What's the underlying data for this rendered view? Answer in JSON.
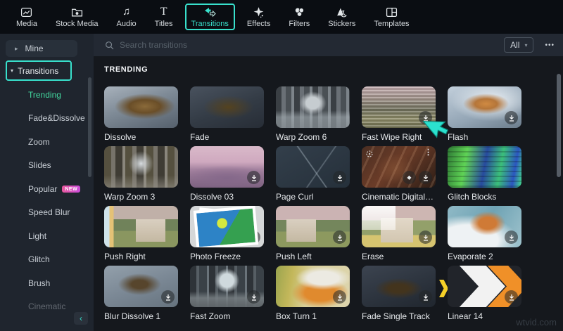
{
  "toolbar": {
    "items": [
      {
        "label": "Media",
        "icon": "media-icon"
      },
      {
        "label": "Stock Media",
        "icon": "stock-media-icon"
      },
      {
        "label": "Audio",
        "icon": "audio-icon"
      },
      {
        "label": "Titles",
        "icon": "titles-icon"
      },
      {
        "label": "Transitions",
        "icon": "transitions-icon",
        "active": true
      },
      {
        "label": "Effects",
        "icon": "effects-icon"
      },
      {
        "label": "Filters",
        "icon": "filters-icon"
      },
      {
        "label": "Stickers",
        "icon": "stickers-icon"
      },
      {
        "label": "Templates",
        "icon": "templates-icon"
      }
    ]
  },
  "sidebar": {
    "mine_label": "Mine",
    "transitions_label": "Transitions",
    "categories": [
      {
        "label": "Trending",
        "selected": true
      },
      {
        "label": "Fade&Dissolve"
      },
      {
        "label": "Zoom"
      },
      {
        "label": "Slides"
      },
      {
        "label": "Popular",
        "badge": "NEW"
      },
      {
        "label": "Speed Blur"
      },
      {
        "label": "Light"
      },
      {
        "label": "Glitch"
      },
      {
        "label": "Brush"
      },
      {
        "label": "Cinematic"
      }
    ]
  },
  "search": {
    "placeholder": "Search transitions"
  },
  "filterbar": {
    "all_label": "All"
  },
  "section_title": "TRENDING",
  "grid": {
    "items": [
      {
        "label": "Dissolve"
      },
      {
        "label": "Fade"
      },
      {
        "label": "Warp Zoom 6"
      },
      {
        "label": "Fast Wipe Right",
        "has_download": true
      },
      {
        "label": "Flash",
        "has_download": true
      },
      {
        "label": "Warp Zoom 3"
      },
      {
        "label": "Dissolve 03",
        "has_download": true
      },
      {
        "label": "Page Curl",
        "has_download": true
      },
      {
        "label": "Cinematic Digital Slid...",
        "has_download": true,
        "has_pro_badge": true,
        "has_menu": true,
        "has_focus": true
      },
      {
        "label": "Glitch Blocks"
      },
      {
        "label": "Push Right"
      },
      {
        "label": "Photo Freeze",
        "has_download": true
      },
      {
        "label": "Push Left",
        "has_download": true
      },
      {
        "label": "Erase",
        "has_download": true
      },
      {
        "label": "Evaporate 2",
        "has_download": true
      },
      {
        "label": "Blur Dissolve 1",
        "has_download": true
      },
      {
        "label": "Fast Zoom",
        "has_download": true
      },
      {
        "label": "Box Turn 1",
        "has_download": true
      },
      {
        "label": "Fade Single Track",
        "has_download": true
      },
      {
        "label": "Linear 14",
        "has_download": true
      }
    ]
  },
  "icons": {
    "audio": "♫",
    "titles": "T",
    "mine_arrow": "▸",
    "group_caret": "▾",
    "collapse": "‹",
    "kebab": "⋮",
    "more": "•••",
    "pro": "◆",
    "all_chevron": "▾"
  },
  "watermark": "wtvid.com",
  "colors": {
    "accent": "#38e0cc",
    "selected_category": "#43d9a0",
    "badge_from": "#e85a9e",
    "badge_to": "#cb4ddb"
  }
}
